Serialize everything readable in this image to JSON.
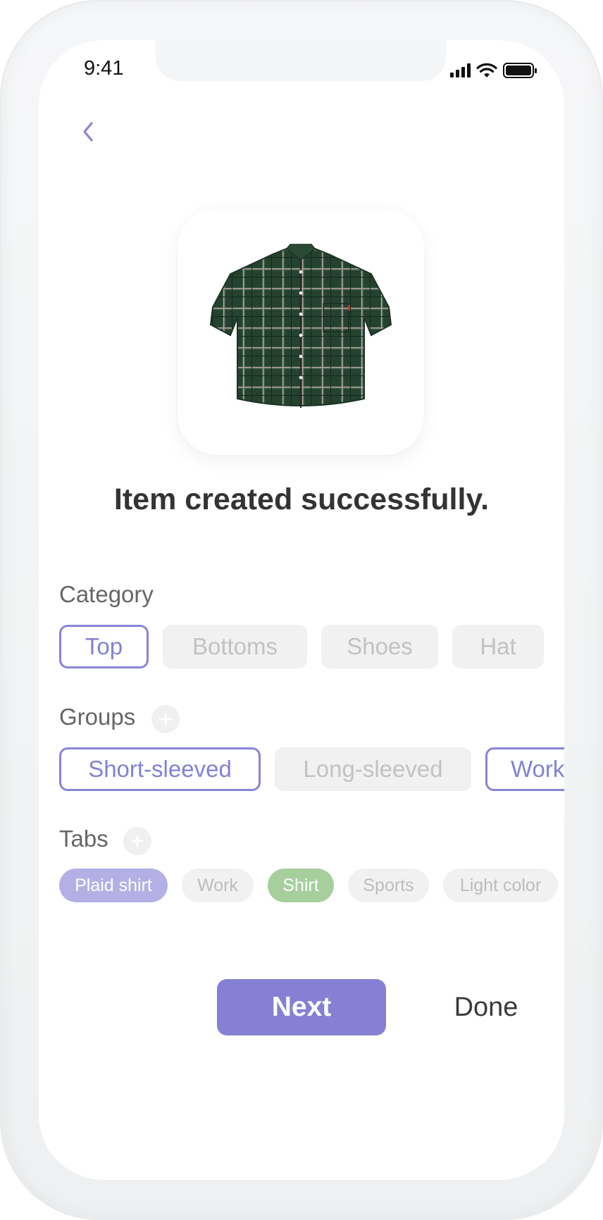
{
  "status_bar": {
    "time": "9:41",
    "icons": [
      "signal-icon",
      "wifi-icon",
      "battery-icon"
    ]
  },
  "nav": {
    "back_icon": "chevron-left-icon"
  },
  "item": {
    "image": "plaid-shirt-image"
  },
  "title": "Item created successfully.",
  "category": {
    "label": "Category",
    "options": [
      {
        "label": "Top",
        "selected": true
      },
      {
        "label": "Bottoms",
        "selected": false
      },
      {
        "label": "Shoes",
        "selected": false
      },
      {
        "label": "Hat",
        "selected": false
      }
    ]
  },
  "groups": {
    "label": "Groups",
    "add_icon": "plus-icon",
    "options": [
      {
        "label": "Short-sleeved",
        "selected": true
      },
      {
        "label": "Long-sleeved",
        "selected": false
      },
      {
        "label": "Work",
        "selected": true
      }
    ]
  },
  "tabs": {
    "label": "Tabs",
    "add_icon": "plus-icon",
    "options": [
      {
        "label": "Plaid shirt",
        "color": "#b4b0e6"
      },
      {
        "label": "Work",
        "color": "#f1f1f1"
      },
      {
        "label": "Shirt",
        "color": "#a6cf9d"
      },
      {
        "label": "Sports",
        "color": "#f1f1f1"
      },
      {
        "label": "Light color",
        "color": "#f1f1f1"
      }
    ]
  },
  "actions": {
    "next": "Next",
    "done": "Done"
  },
  "colors": {
    "accent": "#8580d3",
    "selected_border": "#8a84d6",
    "green_tag": "#a6cf9d",
    "purple_tag": "#b4b0e6"
  }
}
